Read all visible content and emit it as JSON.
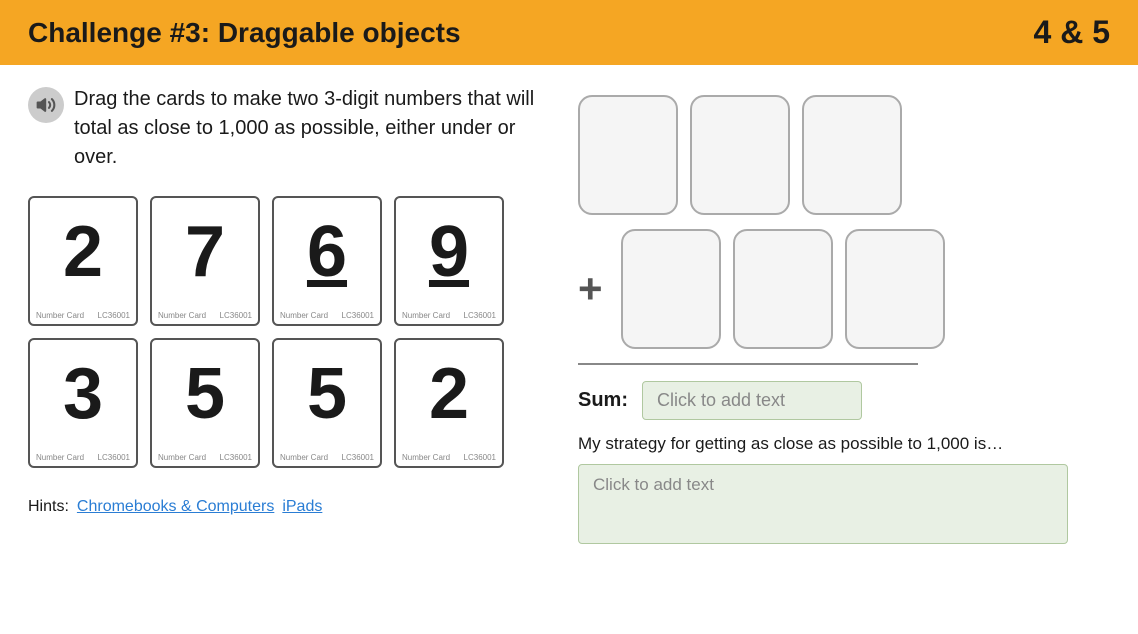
{
  "header": {
    "title": "Challenge #3: Draggable objects",
    "grades": "4 & 5"
  },
  "instruction": {
    "text": "Drag the cards to make two 3-digit numbers that will total as close to 1,000 as possible, either under or over."
  },
  "cards": [
    {
      "value": "2",
      "underlined": false,
      "label": "Number Card",
      "code": "LC36001"
    },
    {
      "value": "7",
      "underlined": false,
      "label": "Number Card",
      "code": "LC36001"
    },
    {
      "value": "6",
      "underlined": true,
      "label": "Number Card",
      "code": "LC36001"
    },
    {
      "value": "9",
      "underlined": true,
      "label": "Number Card",
      "code": "LC36001"
    },
    {
      "value": "3",
      "underlined": false,
      "label": "Number Card",
      "code": "LC36001"
    },
    {
      "value": "5",
      "underlined": false,
      "label": "Number Card",
      "code": "LC36001"
    },
    {
      "value": "5",
      "underlined": false,
      "label": "Number Card",
      "code": "LC36001"
    },
    {
      "value": "2",
      "underlined": false,
      "label": "Number Card",
      "code": "LC36001"
    }
  ],
  "hints": {
    "label": "Hints:",
    "links": [
      {
        "text": "Chromebooks & Computers",
        "url": "#"
      },
      {
        "text": "iPads",
        "url": "#"
      }
    ]
  },
  "drop_zones_top": [
    "",
    "",
    ""
  ],
  "drop_zones_bottom": [
    "",
    "",
    ""
  ],
  "plus_symbol": "+",
  "sum": {
    "label": "Sum:",
    "placeholder": "Click to add text"
  },
  "strategy": {
    "label": "My strategy for getting as close as possible to 1,000 is…",
    "placeholder": "Click to add text"
  }
}
